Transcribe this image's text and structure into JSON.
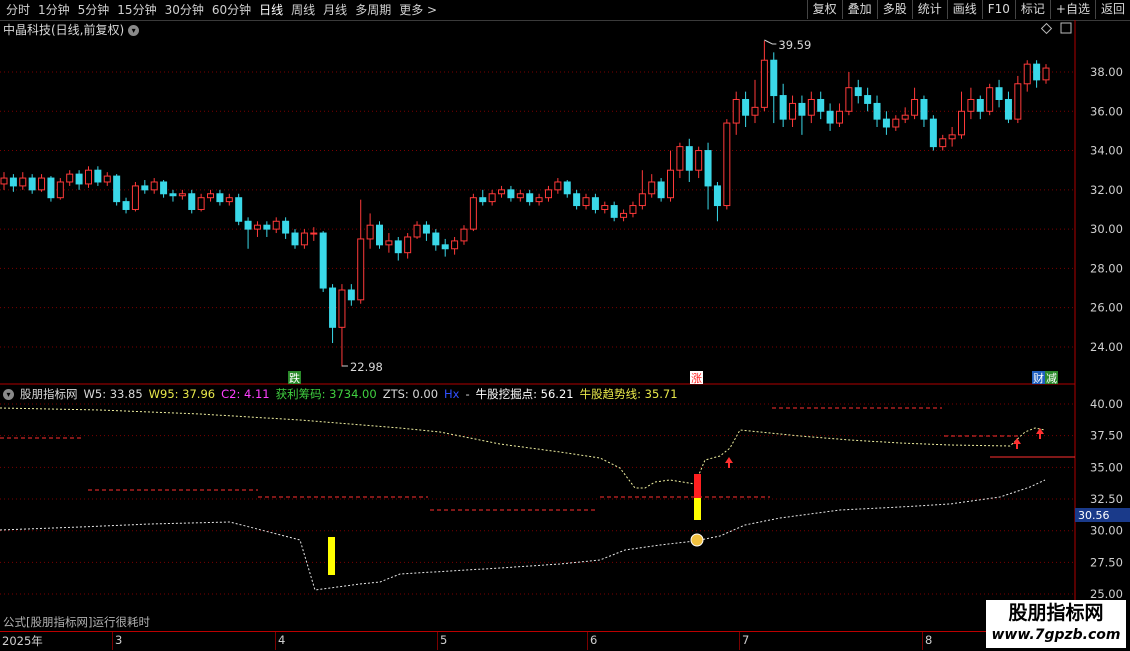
{
  "toolbar": {
    "periods": [
      "分时",
      "1分钟",
      "5分钟",
      "15分钟",
      "30分钟",
      "60分钟",
      "日线",
      "周线",
      "月线",
      "多周期",
      "更多 >"
    ],
    "active_period": "日线",
    "buttons": [
      "复权",
      "叠加",
      "多股",
      "统计",
      "画线",
      "F10",
      "标记",
      "+自选",
      "返回"
    ]
  },
  "chart_title": "中晶科技(日线,前复权)",
  "main_chart": {
    "price_labels": [
      "38.00",
      "36.00",
      "34.00",
      "32.00",
      "30.00",
      "28.00",
      "26.00",
      "24.00"
    ],
    "high_annot": "39.59",
    "low_annot": "22.98",
    "tags": [
      "跌",
      "涨",
      "财",
      "减"
    ]
  },
  "indicator": {
    "name": "股朋指标网",
    "items": [
      {
        "text": "W5: 33.85",
        "color": "#d8d8d8"
      },
      {
        "text": "W95: 37.96",
        "color": "#e8e84a"
      },
      {
        "text": "C2: 4.11",
        "color": "#ff40ff"
      },
      {
        "text": "获利筹码: 3734.00",
        "color": "#40d040"
      },
      {
        "text": "ZTS: 0.00",
        "color": "#d8d8d8"
      },
      {
        "text": "Hx",
        "color": "#3050ff"
      },
      {
        "text": "-",
        "color": "#d8d8d8"
      },
      {
        "text": "牛股挖掘点: 56.21",
        "color": "#ffffff"
      },
      {
        "text": "牛股趋势线: 35.71",
        "color": "#e8e84a"
      }
    ],
    "axis_labels": [
      "40.00",
      "37.50",
      "35.00",
      "32.50",
      "30.00",
      "27.50",
      "25.00"
    ],
    "current_value": "30.56"
  },
  "footer_note": "公式[股朋指标网]运行很耗时",
  "dates": [
    {
      "label": "2025年"
    },
    {
      "label": "3"
    },
    {
      "label": "4"
    },
    {
      "label": "5"
    },
    {
      "label": "6"
    },
    {
      "label": "7"
    },
    {
      "label": "8"
    }
  ],
  "watermark": {
    "name": "股朋指标网",
    "url": "www.7gpzb.com"
  },
  "colors": {
    "up": "#ff3a3a",
    "down": "#3ad8e8",
    "grid": "#7a0000",
    "axis": "#b00000"
  }
}
